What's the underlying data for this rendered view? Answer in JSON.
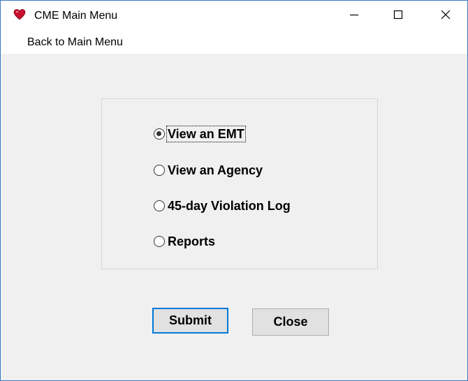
{
  "window": {
    "title": "CME Main Menu",
    "app_icon": "heart-icon",
    "controls": {
      "minimize_icon": "minimize-icon",
      "maximize_icon": "maximize-icon",
      "close_icon": "close-icon"
    }
  },
  "menubar": {
    "items": [
      {
        "label": "Back to Main Menu"
      }
    ]
  },
  "options": [
    {
      "label": "View an EMT",
      "checked": true,
      "focused": true
    },
    {
      "label": "View an Agency",
      "checked": false,
      "focused": false
    },
    {
      "label": "45-day Violation Log",
      "checked": false,
      "focused": false
    },
    {
      "label": "Reports",
      "checked": false,
      "focused": false
    }
  ],
  "buttons": {
    "submit_label": "Submit",
    "close_label": "Close"
  },
  "colors": {
    "window_border": "#3b78c4",
    "client_background": "#f0f0f0",
    "default_button_border": "#0078d7",
    "icon_heart": "#c8102e"
  }
}
